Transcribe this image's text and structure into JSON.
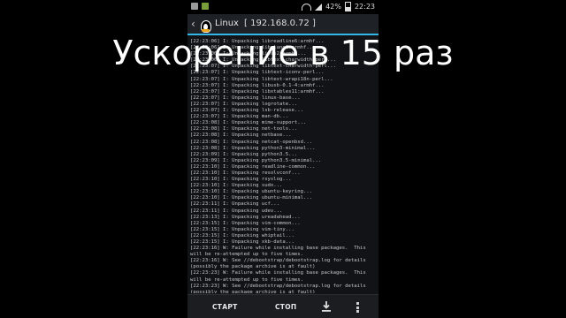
{
  "statusbar": {
    "battery": "42%",
    "time": "22:23",
    "icons": [
      "usb-icon",
      "android-debug-icon",
      "wifi-icon",
      "signal-icon",
      "battery-icon"
    ]
  },
  "actionbar": {
    "title": "Linux",
    "ip": "[ 192.168.0.72 ]"
  },
  "overlay": {
    "caption": "Ускорение в 15 раз"
  },
  "terminal": {
    "lines": [
      "[22:23:06] I: Unpacking libreadline6:armhf...",
      "[22:23:06] I: Unpacking libslang2:armhf...",
      "[22:23:06] I: Unpacking libss2:armhf...",
      "[22:23:06] I: Unpacking libtext-charwidth-perl...",
      "[22:23:07] I: Unpacking libtext-charwidth-perl...",
      "[22:23:07] I: Unpacking libtext-iconv-perl...",
      "[22:23:07] I: Unpacking libtext-wrapi18n-perl...",
      "[22:23:07] I: Unpacking libusb-0.1-4:armhf...",
      "[22:23:07] I: Unpacking libxtables11:armhf...",
      "[22:23:07] I: Unpacking linux-base...",
      "[22:23:07] I: Unpacking logrotate...",
      "[22:23:07] I: Unpacking lsb-release...",
      "[22:23:07] I: Unpacking man-db...",
      "[22:23:08] I: Unpacking mime-support...",
      "[22:23:08] I: Unpacking net-tools...",
      "[22:23:08] I: Unpacking netbase...",
      "[22:23:08] I: Unpacking netcat-openbsd...",
      "[22:23:08] I: Unpacking python3-minimal...",
      "[22:23:09] I: Unpacking python3.5...",
      "[22:23:09] I: Unpacking python3.5-minimal...",
      "[22:23:10] I: Unpacking readline-common...",
      "[22:23:10] I: Unpacking resolvconf...",
      "[22:23:10] I: Unpacking rsyslog...",
      "[22:23:10] I: Unpacking sudo...",
      "[22:23:10] I: Unpacking ubuntu-keyring...",
      "[22:23:10] I: Unpacking ubuntu-minimal...",
      "[22:23:11] I: Unpacking ucf...",
      "[22:23:11] I: Unpacking udev...",
      "[22:23:13] I: Unpacking ureadahead...",
      "[22:23:15] I: Unpacking vim-common...",
      "[22:23:15] I: Unpacking vim-tiny...",
      "[22:23:15] I: Unpacking whiptail...",
      "[22:23:15] I: Unpacking xkb-data...",
      "[22:23:16] W: Failure while installing base packages.  This",
      "will be re-attempted up to five times.",
      "[22:23:16] W: See //debootstrap/debootstrap.log for details",
      "(possibly the package archive is at fault)",
      "[22:23:23] W: Failure while installing base packages.  This",
      "will be re-attempted up to five times.",
      "[22:23:23] W: See //debootstrap/debootstrap.log for details",
      "(possibly the package archive is at fault)"
    ]
  },
  "bottombar": {
    "start": "СТАРТ",
    "stop": "СТОП"
  }
}
